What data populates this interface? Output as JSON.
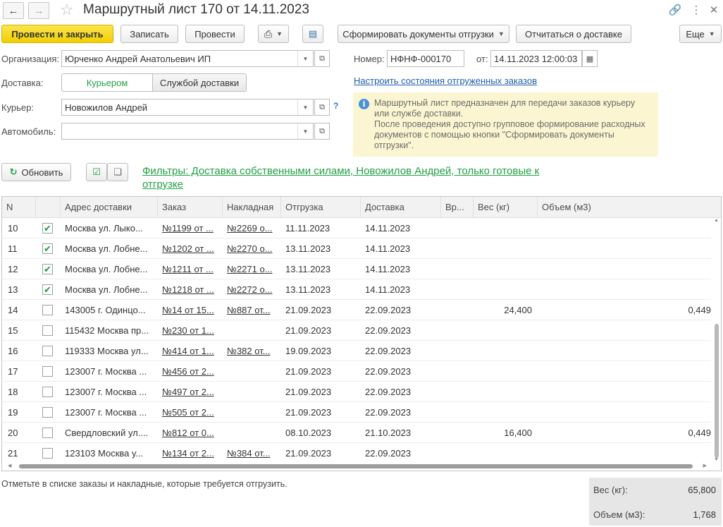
{
  "window": {
    "title": "Маршрутный лист 170 от 14.11.2023",
    "back_icon": "arrow-left-icon",
    "forward_icon": "arrow-right-icon",
    "favorite_icon": "star-icon",
    "link_icon": "link-icon",
    "more_icon": "more-vertical-icon",
    "close_icon": "close-icon"
  },
  "toolbar": {
    "post_and_close": "Провести и закрыть",
    "save": "Записать",
    "post": "Провести",
    "print_icon": "printer-icon",
    "structure_icon": "structure-icon",
    "generate_docs": "Сформировать документы отгрузки",
    "report_delivery": "Отчитаться о доставке",
    "more": "Еще"
  },
  "form": {
    "org_label": "Организация:",
    "org_value": "Юрченко Андрей Анатольевич ИП",
    "number_label": "Номер:",
    "number_value": "НФНФ-000170",
    "date_label": "от:",
    "date_value": "14.11.2023 12:00:03",
    "delivery_label": "Доставка:",
    "delivery_options": [
      "Курьером",
      "Службой доставки"
    ],
    "delivery_selected": "Курьером",
    "configure_link": "Настроить состояния отгруженных заказов",
    "courier_label": "Курьер:",
    "courier_value": "Новожилов Андрей",
    "help_mark": "?",
    "car_label": "Автомобиль:",
    "car_value": ""
  },
  "info": {
    "line1": "Маршрутный лист предназначен для передачи заказов курьеру",
    "line2": "или службе доставки.",
    "line3": "После проведения доступно групповое формирование расходных",
    "line4": "документов с помощью кнопки \"Сформировать документы",
    "line5": "отгрузки\"."
  },
  "list_toolbar": {
    "refresh": "Обновить",
    "filters_line1": "Фильтры: Доставка собственными силами, Новожилов Андрей, только готовые к",
    "filters_line2": "отгрузке"
  },
  "table": {
    "columns": [
      "N",
      "",
      "Адрес доставки",
      "Заказ",
      "Накладная",
      "Отгрузка",
      "Доставка",
      "Вр...",
      "Вес (кг)",
      "Объем (м3)"
    ],
    "rows": [
      {
        "n": "10",
        "checked": true,
        "address": "Москва ул. Лыко...",
        "order": "№1199 от ...",
        "invoice": "№2269 о...",
        "ship": "11.11.2023",
        "delivery": "14.11.2023",
        "time": "",
        "weight": "",
        "volume": ""
      },
      {
        "n": "11",
        "checked": true,
        "address": "Москва ул. Лобне...",
        "order": "№1202 от ...",
        "invoice": "№2270 о...",
        "ship": "13.11.2023",
        "delivery": "14.11.2023",
        "time": "",
        "weight": "",
        "volume": ""
      },
      {
        "n": "12",
        "checked": true,
        "address": "Москва ул. Лобне...",
        "order": "№1211 от ...",
        "invoice": "№2271 о...",
        "ship": "13.11.2023",
        "delivery": "14.11.2023",
        "time": "",
        "weight": "",
        "volume": ""
      },
      {
        "n": "13",
        "checked": true,
        "address": "Москва ул. Лобне...",
        "order": "№1218 от ...",
        "invoice": "№2272 о...",
        "ship": "13.11.2023",
        "delivery": "14.11.2023",
        "time": "",
        "weight": "",
        "volume": ""
      },
      {
        "n": "14",
        "checked": false,
        "address": "143005 г. Одинцо...",
        "order": "№14 от 15...",
        "invoice": "№887 от...",
        "ship": "21.09.2023",
        "delivery": "22.09.2023",
        "time": "",
        "weight": "24,400",
        "volume": "0,449"
      },
      {
        "n": "15",
        "checked": false,
        "address": "115432 Москва пр...",
        "order": "№230 от 1...",
        "invoice": "",
        "ship": "21.09.2023",
        "delivery": "22.09.2023",
        "time": "",
        "weight": "",
        "volume": ""
      },
      {
        "n": "16",
        "checked": false,
        "address": "119333 Москва ул...",
        "order": "№414 от 1...",
        "invoice": "№382 от...",
        "ship": "19.09.2023",
        "delivery": "22.09.2023",
        "time": "",
        "weight": "",
        "volume": ""
      },
      {
        "n": "17",
        "checked": false,
        "address": "123007 г. Москва ...",
        "order": "№456 от 2...",
        "invoice": "",
        "ship": "21.09.2023",
        "delivery": "22.09.2023",
        "time": "",
        "weight": "",
        "volume": ""
      },
      {
        "n": "18",
        "checked": false,
        "address": "123007 г. Москва ...",
        "order": "№497 от 2...",
        "invoice": "",
        "ship": "21.09.2023",
        "delivery": "22.09.2023",
        "time": "",
        "weight": "",
        "volume": ""
      },
      {
        "n": "19",
        "checked": false,
        "address": "123007 г. Москва ...",
        "order": "№505 от 2...",
        "invoice": "",
        "ship": "21.09.2023",
        "delivery": "22.09.2023",
        "time": "",
        "weight": "",
        "volume": ""
      },
      {
        "n": "20",
        "checked": false,
        "address": "Свердловский ул....",
        "order": "№812 от 0...",
        "invoice": "",
        "ship": "08.10.2023",
        "delivery": "21.10.2023",
        "time": "",
        "weight": "16,400",
        "volume": "0,449"
      },
      {
        "n": "21",
        "checked": false,
        "address": "123103 Москва у...",
        "order": "№134 от 2...",
        "invoice": "№384 от...",
        "ship": "21.09.2023",
        "delivery": "22.09.2023",
        "time": "",
        "weight": "",
        "volume": ""
      }
    ]
  },
  "footer": {
    "hint": "Отметьте в списке заказы и накладные, которые требуется отгрузить.",
    "weight_label": "Вес (кг):",
    "weight_value": "65,800",
    "volume_label": "Объем (м3):",
    "volume_value": "1,768"
  },
  "colors": {
    "accent_yellow": "#f2cf00",
    "link_blue": "#1f5fa8",
    "filter_green": "#22a045",
    "info_bg": "#fbf6d1",
    "check_green": "#1d9b3c"
  }
}
